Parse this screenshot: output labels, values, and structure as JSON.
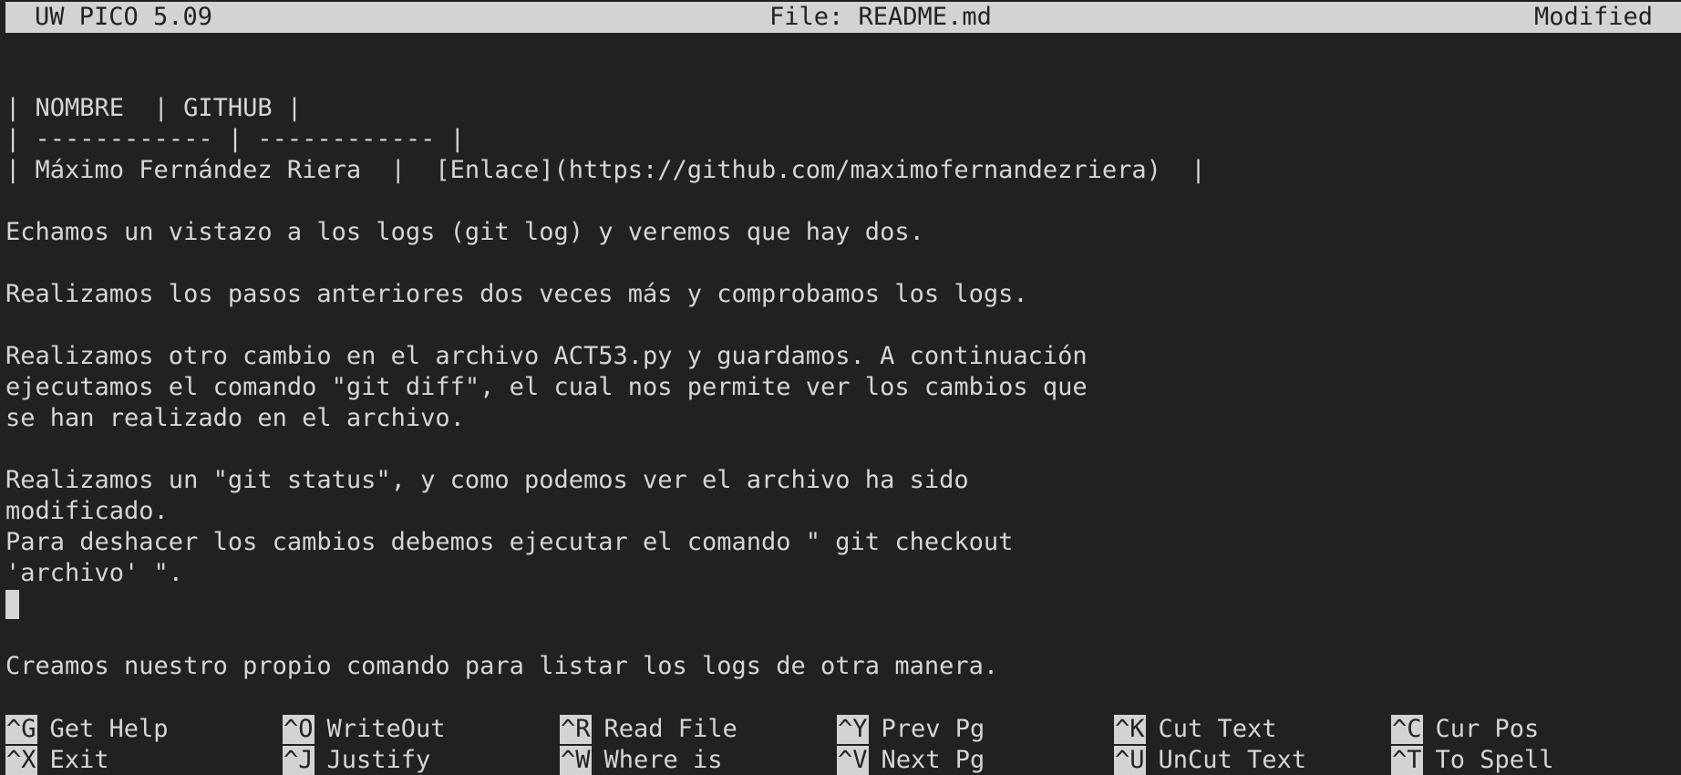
{
  "title_bar": {
    "app": "UW PICO 5.09",
    "file": "File: README.md",
    "status": "Modified"
  },
  "editor": {
    "lines": [
      "| NOMBRE  | GITHUB |",
      "| ------------ | ------------ |",
      "| Máximo Fernández Riera  |  [Enlace](https://github.com/maximofernandezriera)  |",
      "",
      "Echamos un vistazo a los logs (git log) y veremos que hay dos.",
      "",
      "Realizamos los pasos anteriores dos veces más y comprobamos los logs.",
      "",
      "Realizamos otro cambio en el archivo ACT53.py y guardamos. A continuación",
      "ejecutamos el comando \"git diff\", el cual nos permite ver los cambios que",
      "se han realizado en el archivo.",
      "",
      "Realizamos un \"git status\", y como podemos ver el archivo ha sido",
      "modificado.",
      "Para deshacer los cambios debemos ejecutar el comando \" git checkout",
      "'archivo' \".",
      "",
      "",
      "Creamos nuestro propio comando para listar los logs de otra manera."
    ],
    "cursor_line": 16
  },
  "shortcuts": [
    {
      "key": "^G",
      "label": "Get Help"
    },
    {
      "key": "^O",
      "label": "WriteOut"
    },
    {
      "key": "^R",
      "label": "Read File"
    },
    {
      "key": "^Y",
      "label": "Prev Pg"
    },
    {
      "key": "^K",
      "label": "Cut Text"
    },
    {
      "key": "^C",
      "label": "Cur Pos"
    },
    {
      "key": "^X",
      "label": "Exit"
    },
    {
      "key": "^J",
      "label": "Justify"
    },
    {
      "key": "^W",
      "label": "Where is"
    },
    {
      "key": "^V",
      "label": "Next Pg"
    },
    {
      "key": "^U",
      "label": "UnCut Text"
    },
    {
      "key": "^T",
      "label": "To Spell"
    }
  ],
  "colors": {
    "background": "#212121",
    "foreground": "#d6d6d6",
    "inverse_bg": "#d3d3d3",
    "inverse_fg": "#222222"
  }
}
